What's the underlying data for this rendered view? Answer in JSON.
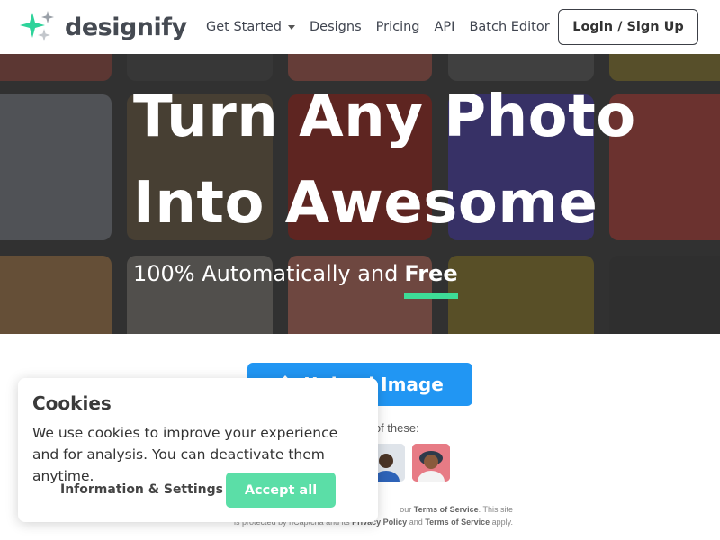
{
  "header": {
    "logo_text": "designify",
    "nav": [
      {
        "label": "Get Started",
        "has_dropdown": true
      },
      {
        "label": "Designs"
      },
      {
        "label": "Pricing"
      },
      {
        "label": "API"
      },
      {
        "label": "Batch Editor"
      }
    ],
    "login_label": "Login / Sign Up"
  },
  "hero": {
    "title_line1": "Turn Any Photo",
    "title_line2": "Into Awesome",
    "subtitle": "100% Automatically and",
    "subtitle_emphasis": "Free"
  },
  "upload": {
    "button_label": "Upload Image",
    "try_text": "e of these:"
  },
  "legal": {
    "line1_prefix": "our",
    "line1_link": "Terms of Service",
    "line1_suffix": ". This site",
    "line2_prefix": "is protected by hCaptcha and its",
    "line2_link1": "Privacy Policy",
    "line2_mid": "and",
    "line2_link2": "Terms of Service",
    "line2_suffix": "apply."
  },
  "cookie": {
    "title": "Cookies",
    "text": "We use cookies to improve your experience and for analysis. You can deactivate them anytime.",
    "settings_label": "Information & Settings",
    "accept_label": "Accept all"
  },
  "colors": {
    "brand_green": "#3ddc97",
    "upload_blue": "#2196f3",
    "accept_green": "#5bdea7",
    "logo_text": "#454a52"
  },
  "icons": [
    "sparkle-logo-icon",
    "caret-down-icon",
    "upload-arrow-icon"
  ]
}
